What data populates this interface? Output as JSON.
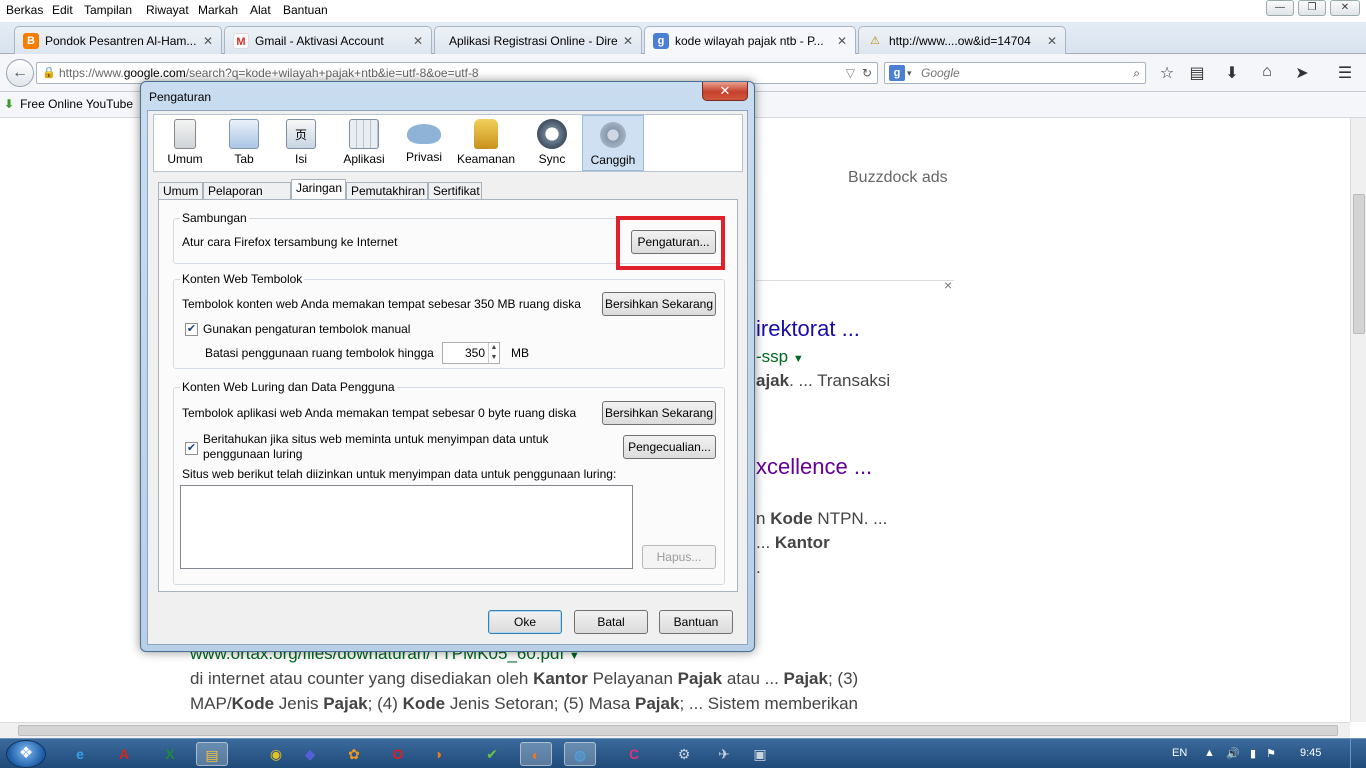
{
  "menubar": {
    "items": [
      "Berkas",
      "Edit",
      "Tampilan",
      "Riwayat",
      "Markah",
      "Alat",
      "Bantuan"
    ]
  },
  "window_controls": {
    "minimize": "—",
    "restore": "❐",
    "close": "✕"
  },
  "tabs": [
    {
      "title": "Pondok Pesantren Al-Ham...",
      "icon": "blogger-icon",
      "color": "#f57d00"
    },
    {
      "title": "Gmail - Aktivasi Account",
      "icon": "gmail-icon",
      "color": "#d93025"
    },
    {
      "title": "Aplikasi Registrasi Online - Dire...",
      "icon": "blank-page-icon",
      "color": "#dfe6ee"
    },
    {
      "title": "kode wilayah pajak ntb - P...",
      "icon": "google-icon",
      "color": "#4a7fd4"
    },
    {
      "title": "http://www....ow&id=14704",
      "icon": "warning-icon",
      "color": "#f2c200"
    }
  ],
  "new_tab_label": "+",
  "navbar": {
    "url_prefix": "https://www.",
    "url_domain": "google.com",
    "url_rest": "/search?q=kode+wilayah+pajak+ntb&ie=utf-8&oe=utf-8",
    "search_placeholder": "Google",
    "search_engine_glyph": "g"
  },
  "bookmarks": {
    "item": "Free Online YouTube"
  },
  "page": {
    "ads": "Buzzdock ads",
    "close_x": "×",
    "r1_title": "irektorat ...",
    "r1_url": "-ssp",
    "r1_snip_b": "ajak",
    "r1_snip": ". ... Transaksi",
    "r2_title": "xcellence ...",
    "r2_snip1_pre": "n ",
    "r2_snip1_b": "Kode",
    "r2_snip1_post": " NTPN. ...",
    "r2_snip2_pre": "... ",
    "r2_snip2_b": "Kantor",
    "r2_dot": ".",
    "r3_url": "www.ortax.org/files/downaturan/TTPMK05_60.pdf",
    "r3_l1_a": "di internet atau counter yang disediakan oleh ",
    "r3_l1_b": "Kantor",
    "r3_l1_c": " Pelayanan ",
    "r3_l1_d": "Pajak",
    "r3_l1_e": " atau ... ",
    "r3_l1_f": "Pajak",
    "r3_l1_g": "; (3)",
    "r3_l2_a": "MAP/",
    "r3_l2_b": "Kode",
    "r3_l2_c": " Jenis ",
    "r3_l2_d": "Pajak",
    "r3_l2_e": "; (4) ",
    "r3_l2_f": "Kode",
    "r3_l2_g": " Jenis Setoran; (5) Masa ",
    "r3_l2_h": "Pajak",
    "r3_l2_i": "; ... Sistem memberikan"
  },
  "dialog": {
    "title": "Pengaturan",
    "close": "✕",
    "panes": [
      "Umum",
      "Tab",
      "Isi",
      "Aplikasi",
      "Privasi",
      "Keamanan",
      "Sync",
      "Canggih"
    ],
    "active_pane": "Canggih",
    "subtabs": [
      "Umum",
      "Pelaporan Data",
      "Jaringan",
      "Pemutakhiran",
      "Sertifikat"
    ],
    "active_subtab": "Jaringan",
    "connection": {
      "title": "Sambungan",
      "desc": "Atur cara Firefox tersambung ke Internet",
      "button": "Pengaturan..."
    },
    "cache": {
      "title": "Konten Web Tembolok",
      "desc": "Tembolok konten web Anda memakan tempat sebesar 350 MB ruang diska",
      "clear_button": "Bersihkan Sekarang",
      "manual_label": "Gunakan pengaturan tembolok manual",
      "manual_checked": true,
      "limit_label": "Batasi penggunaan ruang tembolok hingga",
      "limit_value": "350",
      "limit_unit": "MB"
    },
    "offline": {
      "title": "Konten Web Luring dan Data Pengguna",
      "desc": "Tembolok aplikasi web Anda memakan tempat sebesar 0 byte ruang diska",
      "clear_button": "Bersihkan Sekarang",
      "notify_label_1": "Beritahukan jika situs web meminta untuk menyimpan data untuk",
      "notify_label_2": "penggunaan luring",
      "notify_checked": true,
      "exceptions_button": "Pengecualian...",
      "allowed_label": "Situs web berikut telah diizinkan untuk menyimpan data untuk penggunaan luring:",
      "remove_button": "Hapus..."
    },
    "buttons": {
      "ok": "Oke",
      "cancel": "Batal",
      "help": "Bantuan"
    }
  },
  "taskbar": {
    "start_glyph": "❖",
    "apps": [
      {
        "name": "ie-icon",
        "glyph": "e",
        "color": "#3aa0e8"
      },
      {
        "name": "acrobat-icon",
        "glyph": "A",
        "color": "#d6261c"
      },
      {
        "name": "excel-icon",
        "glyph": "X",
        "color": "#1f8a3c"
      },
      {
        "name": "explorer-icon",
        "glyph": "▤",
        "color": "#f2c33b"
      },
      {
        "name": "chrome-icon",
        "glyph": "◉",
        "color": "#e8c21e"
      },
      {
        "name": "media-icon",
        "glyph": "◆",
        "color": "#5560d8"
      },
      {
        "name": "paint-icon",
        "glyph": "✿",
        "color": "#f09a1c"
      },
      {
        "name": "opera-icon",
        "glyph": "O",
        "color": "#e01f1f"
      },
      {
        "name": "app-icon",
        "glyph": "◑",
        "color": "#f07a1a"
      },
      {
        "name": "excel2-icon",
        "glyph": "✔",
        "color": "#6bc24a"
      },
      {
        "name": "firefox-icon",
        "glyph": "◐",
        "color": "#f07a1a"
      },
      {
        "name": "swirl-icon",
        "glyph": "◍",
        "color": "#4aa8e8"
      },
      {
        "name": "cclean-icon",
        "glyph": "C",
        "color": "#d8357a"
      },
      {
        "name": "network-icon",
        "glyph": "⚙",
        "color": "#c9d4e0"
      },
      {
        "name": "tool-icon",
        "glyph": "✈",
        "color": "#c9d4e0"
      },
      {
        "name": "display-icon",
        "glyph": "▣",
        "color": "#c9d4e0"
      }
    ],
    "lang": "EN",
    "clock": "9:45"
  }
}
